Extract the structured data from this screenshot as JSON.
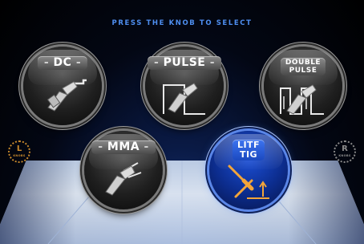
{
  "header": {
    "title": "PRESS THE KNOB TO SELECT"
  },
  "modes": [
    {
      "label": "DC",
      "icon": "torch-icon"
    },
    {
      "label": "PULSE",
      "icon": "torch-pulse-icon"
    },
    {
      "label_line1": "DOUBLE",
      "label_line2": "PULSE",
      "icon": "torch-double-pulse-icon"
    },
    {
      "label": "MMA",
      "icon": "electrode-holder-icon"
    },
    {
      "label_line1": "LITF",
      "label_line2": "TIG",
      "icon": "tig-lift-icon",
      "selected": true
    }
  ],
  "side_buttons": {
    "left": {
      "letter": "L",
      "brand": "KNOBS"
    },
    "right": {
      "letter": "R",
      "brand": "KNOBS"
    }
  },
  "colors": {
    "accent": "#1b49c0",
    "header_text": "#4e8ef0",
    "left_knob": "#c8892c",
    "right_knob": "#8a8a8a",
    "tig_icon": "#f3a53a"
  }
}
